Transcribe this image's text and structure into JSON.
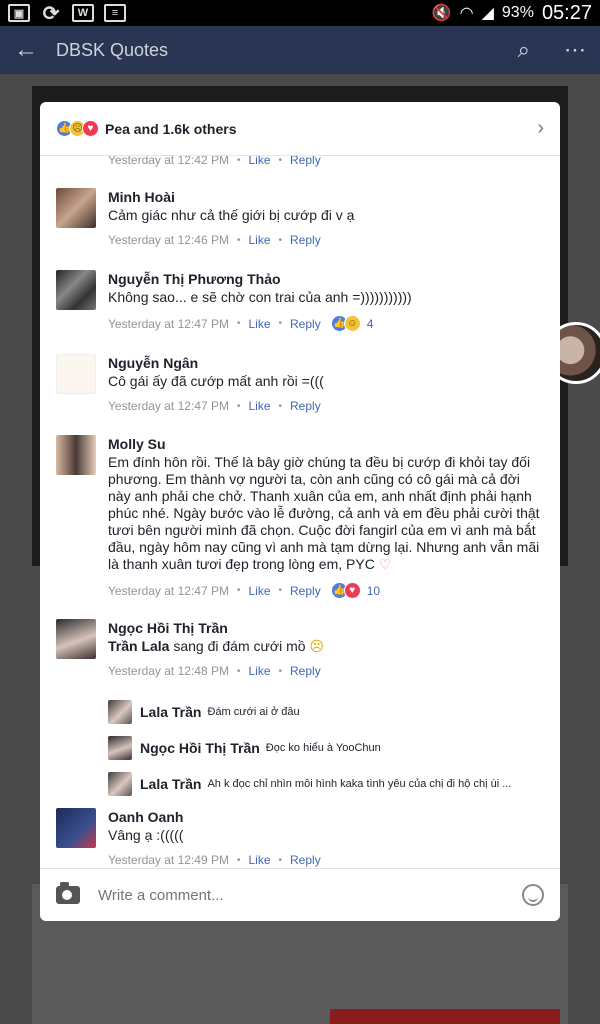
{
  "status_bar": {
    "battery": "93%",
    "time": "05:27"
  },
  "app_bar": {
    "title": "DBSK Quotes"
  },
  "modal": {
    "title": "Pea and 1.6k others",
    "top_meta": {
      "time": "Yesterday at 12:42 PM",
      "like": "Like",
      "reply": "Reply"
    },
    "comments": [
      {
        "name": "Minh Hoài",
        "text": "Cảm giác như cả thế giới bị cướp đi v ạ",
        "time": "Yesterday at 12:46 PM",
        "like": "Like",
        "reply": "Reply"
      },
      {
        "name": "Nguyễn Thị Phương Thảo",
        "text": "Không sao... e sẽ chờ con trai của anh =)))))))))))",
        "time": "Yesterday at 12:47 PM",
        "like": "Like",
        "reply": "Reply",
        "reaction_count": "4"
      },
      {
        "name": "Nguyễn Ngân",
        "text": "Cô gái ấy đã cướp mất anh rồi =(((",
        "time": "Yesterday at 12:47 PM",
        "like": "Like",
        "reply": "Reply"
      },
      {
        "name": "Molly Su",
        "text": "Em đính hôn rồi. Thế là bây giờ chúng ta đều bị cướp đi khỏi tay đối phương. Em thành vợ người ta, còn anh cũng có cô gái mà cả đời này anh phải che chở. Thanh xuân của em, anh nhất định phải hạnh phúc nhé. Ngày bước vào lễ đường, cả anh và em đều phải cười thật tươi bên người mình đã chọn. Cuộc đời fangirl của em vì anh mà bắt đầu, ngày hôm nay cũng vì anh mà tạm dừng lại.   Nhưng anh vẫn mãi là thanh xuân tươi đẹp trong lòng em, PYC",
        "time": "Yesterday at 12:47 PM",
        "like": "Like",
        "reply": "Reply",
        "reaction_count": "10"
      },
      {
        "name": "Ngọc Hồi Thị Trần",
        "mention": "Trần Lala",
        "text": " sang đi đám cưới mồ",
        "time": "Yesterday at 12:48 PM",
        "like": "Like",
        "reply": "Reply"
      },
      {
        "name": "Oanh Oanh",
        "text": "Vâng ạ :(((((",
        "time": "Yesterday at 12:49 PM",
        "like": "Like",
        "reply": "Reply"
      }
    ],
    "replies": [
      {
        "name": "Lala Trần",
        "text": "Đám cưới ai ở đâu"
      },
      {
        "name": "Ngọc Hồi Thị Trần",
        "text": "Đọc ko hiểu à YooChun"
      },
      {
        "name": "Lala Trần",
        "text": "Ah k đọc chỉ nhìn mỗi hình kaka tình yêu của chị đi hộ chị ùi ..."
      }
    ],
    "composer": {
      "placeholder": "Write a comment..."
    }
  }
}
